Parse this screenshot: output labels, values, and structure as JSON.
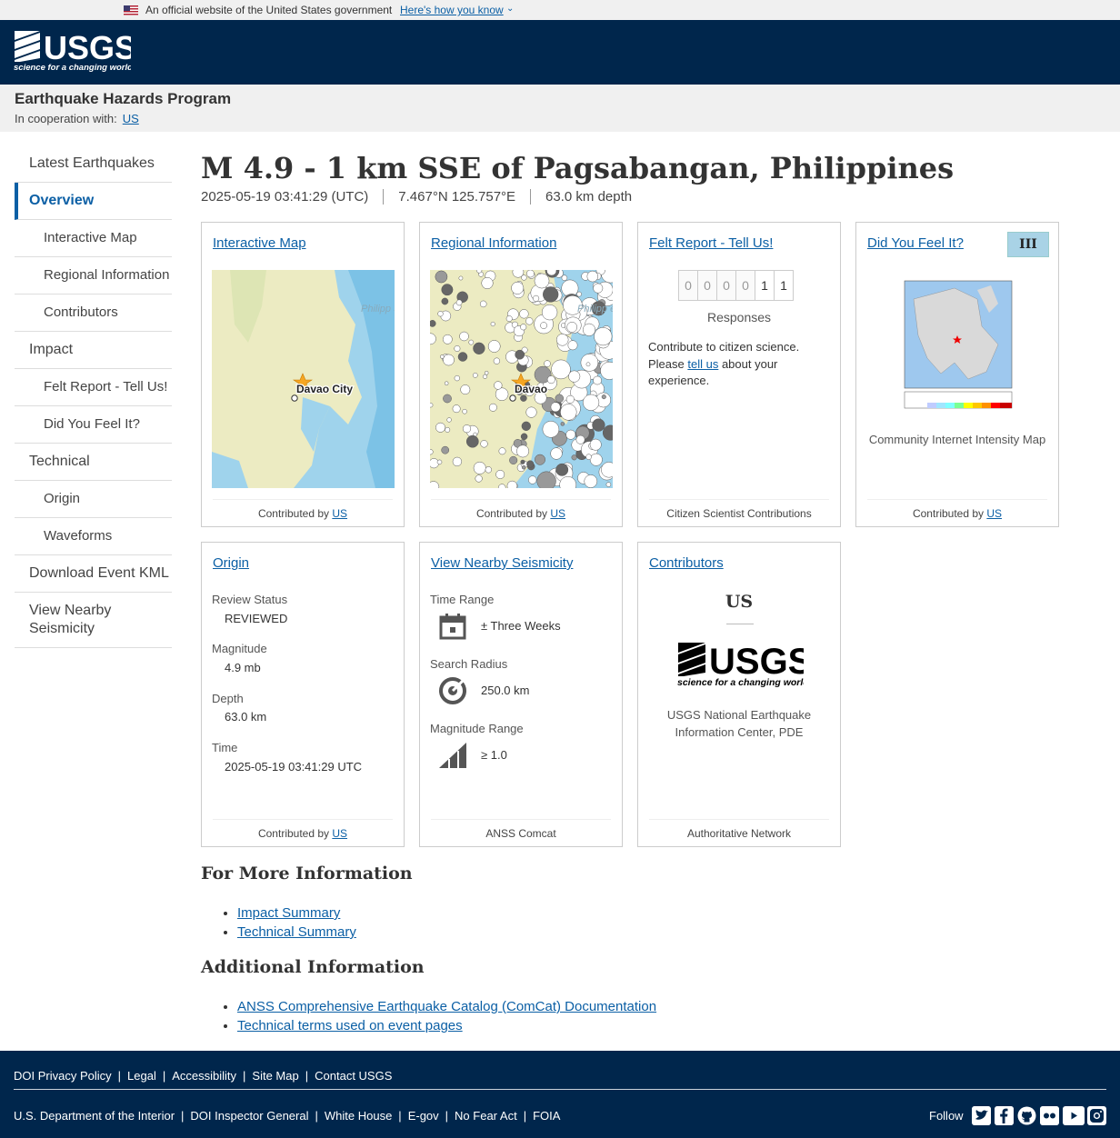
{
  "gov_banner": {
    "official": "An official website of the United States government",
    "how_you_know": "Here's how you know"
  },
  "program": {
    "title": "Earthquake Hazards Program",
    "cooperation_label": "In cooperation with:",
    "cooperation_link": "US"
  },
  "sidebar": {
    "items": [
      {
        "label": "Latest Earthquakes",
        "level": 0
      },
      {
        "label": "Overview",
        "level": 0,
        "active": true
      },
      {
        "label": "Interactive Map",
        "level": 1
      },
      {
        "label": "Regional Information",
        "level": 1
      },
      {
        "label": "Contributors",
        "level": 1
      },
      {
        "label": "Impact",
        "level": 0
      },
      {
        "label": "Felt Report - Tell Us!",
        "level": 1
      },
      {
        "label": "Did You Feel It?",
        "level": 1
      },
      {
        "label": "Technical",
        "level": 0
      },
      {
        "label": "Origin",
        "level": 1
      },
      {
        "label": "Waveforms",
        "level": 1
      },
      {
        "label": "Download Event KML",
        "level": 0
      },
      {
        "label": "View Nearby Seismicity",
        "level": 0
      }
    ]
  },
  "event": {
    "title": "M 4.9 - 1 km SSE of Pagsabangan, Philippines",
    "time": "2025-05-19 03:41:29 (UTC)",
    "location": "7.467°N 125.757°E",
    "depth": "63.0 km depth"
  },
  "cards": {
    "interactive_map": {
      "title": "Interactive Map",
      "contributed_by": "Contributed by",
      "contributor": "US",
      "map_labels": {
        "city": "Davao City",
        "sea": "Philipp Sea"
      }
    },
    "regional": {
      "title": "Regional Information",
      "contributed_by": "Contributed by",
      "contributor": "US",
      "map_labels": {
        "city": "Davao",
        "sea": "Philipp es"
      }
    },
    "felt_report": {
      "title": "Felt Report - Tell Us!",
      "digits": [
        "0",
        "0",
        "0",
        "0",
        "1",
        "1"
      ],
      "responses_label": "Responses",
      "text_before": "Contribute to citizen science. Please ",
      "link": "tell us",
      "text_after": " about your experience.",
      "footer": "Citizen Scientist Contributions"
    },
    "dyfi": {
      "title": "Did You Feel It?",
      "intensity": "III",
      "caption": "Community Internet Intensity Map",
      "contributed_by": "Contributed by",
      "contributor": "US"
    },
    "origin": {
      "title": "Origin",
      "review_status_label": "Review Status",
      "review_status": "REVIEWED",
      "magnitude_label": "Magnitude",
      "magnitude": "4.9 mb",
      "depth_label": "Depth",
      "depth": "63.0 km",
      "time_label": "Time",
      "time": "2025-05-19 03:41:29 UTC",
      "contributed_by": "Contributed by",
      "contributor": "US"
    },
    "nearby": {
      "title": "View Nearby Seismicity",
      "time_range_label": "Time Range",
      "time_range": "± Three Weeks",
      "search_radius_label": "Search Radius",
      "search_radius": "250.0 km",
      "magnitude_range_label": "Magnitude Range",
      "magnitude_range": "≥ 1.0",
      "footer": "ANSS Comcat"
    },
    "contributors": {
      "title": "Contributors",
      "code": "US",
      "name": "USGS National Earthquake Information Center, PDE",
      "footer": "Authoritative Network"
    }
  },
  "more_info": {
    "heading": "For More Information",
    "links": [
      "Impact Summary",
      "Technical Summary"
    ]
  },
  "additional_info": {
    "heading": "Additional Information",
    "links": [
      "ANSS Comprehensive Earthquake Catalog (ComCat) Documentation",
      "Technical terms used on event pages"
    ]
  },
  "footer": {
    "row1": [
      "DOI Privacy Policy",
      "Legal",
      "Accessibility",
      "Site Map",
      "Contact USGS"
    ],
    "row2": [
      "U.S. Department of the Interior",
      "DOI Inspector General",
      "White House",
      "E-gov",
      "No Fear Act",
      "FOIA"
    ],
    "follow": "Follow",
    "social_icons": [
      "twitter-icon",
      "facebook-icon",
      "github-icon",
      "flickr-icon",
      "youtube-icon",
      "instagram-icon"
    ]
  },
  "logo": {
    "wordmark": "USGS",
    "tagline": "science for a changing world"
  },
  "colors": {
    "header": "#00264c",
    "link": "#0b5fa5",
    "intensity_badge": "#a9d3e6"
  }
}
